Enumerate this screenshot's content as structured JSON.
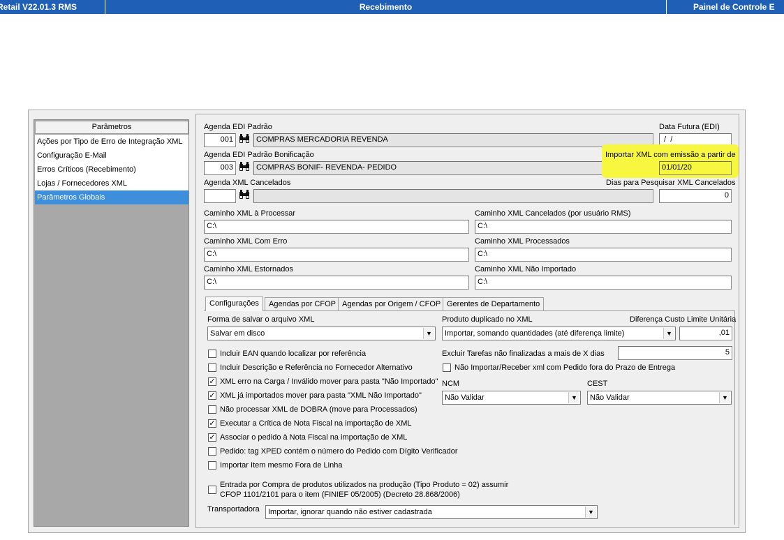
{
  "titlebar": {
    "left": "Retail V22.01.3 RMS",
    "center": "Recebimento",
    "right": "Painel de Controle E"
  },
  "sidebar": {
    "header": "Parâmetros",
    "items": [
      {
        "label": "Ações por Tipo de Erro de Integração XML"
      },
      {
        "label": "Configuração E-Mail"
      },
      {
        "label": "Erros Críticos (Recebimento)"
      },
      {
        "label": "Lojas / Fornecedores XML"
      },
      {
        "label": "Parâmetros Globais",
        "selected": true
      }
    ]
  },
  "agenda_edi": {
    "label": "Agenda EDI Padrão",
    "code": "001",
    "desc": "COMPRAS MERCADORIA REVENDA"
  },
  "data_futura": {
    "label": "Data Futura (EDI)",
    "value": " /  /"
  },
  "agenda_bonif": {
    "label": "Agenda EDI Padrão Bonificação",
    "code": "003",
    "desc": "COMPRAS BONIF- REVENDA- PEDIDO"
  },
  "importar_xml": {
    "label": "Importar XML com emissão a partir de",
    "value": "01/01/20",
    "highlight_color": "#f7f740"
  },
  "agenda_cancelados": {
    "label": "Agenda XML Cancelados",
    "code": "",
    "desc": ""
  },
  "dias_pesquisar": {
    "label": "Dias para Pesquisar XML Cancelados",
    "value": "0"
  },
  "paths": {
    "processar": {
      "label": "Caminho XML à Processar",
      "value": "C:\\"
    },
    "cancelados": {
      "label": "Caminho XML Cancelados (por usuário RMS)",
      "value": "C:\\"
    },
    "com_erro": {
      "label": "Caminho XML Com Erro",
      "value": "C:\\"
    },
    "processados": {
      "label": "Caminho XML Processados",
      "value": "C:\\"
    },
    "estornados": {
      "label": "Caminho XML Estornados",
      "value": "C:\\"
    },
    "nao_importado": {
      "label": "Caminho XML Não Importado",
      "value": "C:\\"
    }
  },
  "tabs": [
    {
      "label": "Configurações",
      "active": true
    },
    {
      "label": "Agendas por CFOP"
    },
    {
      "label": "Agendas por Origem / CFOP"
    },
    {
      "label": "Gerentes de Departamento"
    }
  ],
  "config": {
    "forma_salvar": {
      "label": "Forma de salvar o arquivo XML",
      "value": "Salvar em disco"
    },
    "produto_duplicado": {
      "label": "Produto duplicado no XML",
      "value": "Importar, somando quantidades (até diferença limite)"
    },
    "diferenca_custo": {
      "label": "Diferença Custo Limite Unitária",
      "value": ",01"
    },
    "excluir_tarefas": {
      "label": "Excluir Tarefas não finalizadas a mais de X dias",
      "value": "5"
    },
    "nao_importar_pedido": {
      "label": "Não Importar/Receber xml com Pedido fora do Prazo de Entrega",
      "checked": false
    },
    "ncm": {
      "label": "NCM",
      "value": "Não Validar"
    },
    "cest": {
      "label": "CEST",
      "value": "Não Validar"
    },
    "checkboxes": [
      {
        "label": "Incluir EAN quando localizar por referência",
        "checked": false
      },
      {
        "label": "Incluir Descrição e Referência no Fornecedor Alternativo",
        "checked": false
      },
      {
        "label": "XML erro na Carga / Inválido mover para pasta \"Não Importado\"",
        "checked": true
      },
      {
        "label": "XML já importados mover para pasta \"XML Não Importado\"",
        "checked": true
      },
      {
        "label": "Não processar XML de DOBRA (move para Processados)",
        "checked": false
      },
      {
        "label": "Executar a Crítica de Nota Fiscal na importação de XML",
        "checked": true
      },
      {
        "label": "Associar o pedido à Nota Fiscal na importação de XML",
        "checked": true
      },
      {
        "label": "Pedido: tag XPED contém o número do Pedido com Dígito Verificador",
        "checked": false
      },
      {
        "label": "Importar Item mesmo Fora de Linha",
        "checked": false
      }
    ],
    "entrada_compra": {
      "line1": "Entrada por Compra de produtos utilizados na produção (Tipo Produto = 02) assumir",
      "line2": "CFOP 1101/2101 para o item (FINIEF 05/2005) (Decreto 28.868/2006)",
      "checked": false
    },
    "transportadora": {
      "label": "Transportadora",
      "value": "Importar, ignorar quando não estiver cadastrada"
    }
  },
  "icons": {
    "lookup": "binoculars-icon",
    "dropdown": "chevron-down-icon",
    "check": "checkmark"
  }
}
